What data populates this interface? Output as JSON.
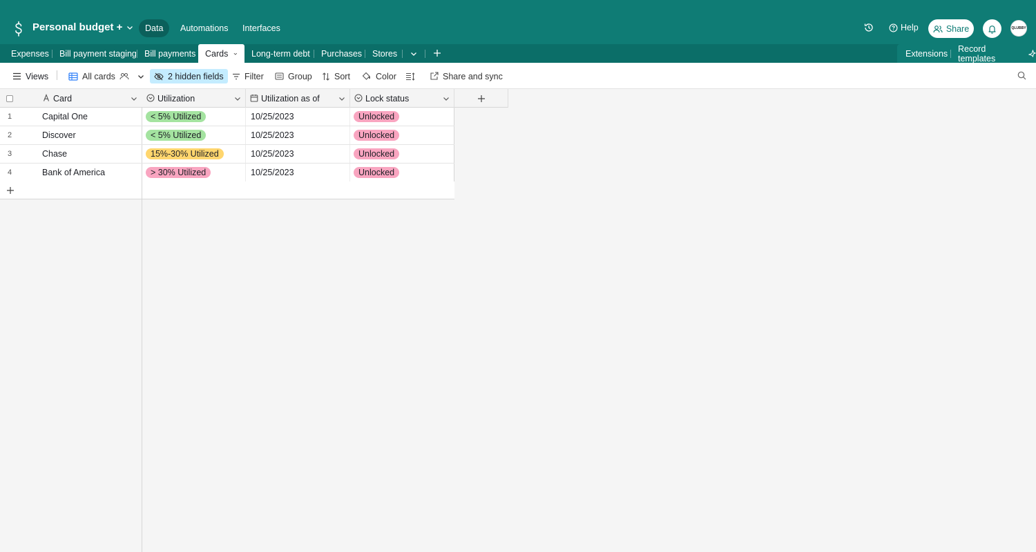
{
  "app": {
    "base_title": "Personal budget +",
    "nav": [
      "Data",
      "Automations",
      "Interfaces"
    ],
    "help_label": "Help",
    "share_label": "Share",
    "avatar_text": "QLUBBY",
    "accent_color": "#0f7c75"
  },
  "tabs": {
    "items": [
      "Expenses",
      "Bill payment staging",
      "Bill payments",
      "Cards",
      "Long-term debt",
      "Purchases",
      "Stores"
    ],
    "active": "Cards",
    "extensions_label": "Extensions",
    "record_templates_label": "Record templates"
  },
  "toolbar": {
    "views_label": "Views",
    "view_name": "All cards",
    "hidden_fields_label": "2 hidden fields",
    "filter_label": "Filter",
    "group_label": "Group",
    "sort_label": "Sort",
    "color_label": "Color",
    "share_sync_label": "Share and sync"
  },
  "grid": {
    "columns": [
      "Card",
      "Utilization",
      "Utilization as of",
      "Lock status"
    ],
    "rows": [
      {
        "num": "1",
        "card": "Capital One",
        "utilization": "< 5% Utilized",
        "util_color": "#a4e3a0",
        "date": "10/25/2023",
        "lock": "Unlocked"
      },
      {
        "num": "2",
        "card": "Discover",
        "utilization": "< 5% Utilized",
        "util_color": "#a4e3a0",
        "date": "10/25/2023",
        "lock": "Unlocked"
      },
      {
        "num": "3",
        "card": "Chase",
        "utilization": "15%-30% Utilized",
        "util_color": "#ffd66e",
        "date": "10/25/2023",
        "lock": "Unlocked"
      },
      {
        "num": "4",
        "card": "Bank of America",
        "utilization": "> 30% Utilized",
        "util_color": "#f9a5c0",
        "date": "10/25/2023",
        "lock": "Unlocked"
      }
    ],
    "lock_color": "#f9a5c0"
  }
}
